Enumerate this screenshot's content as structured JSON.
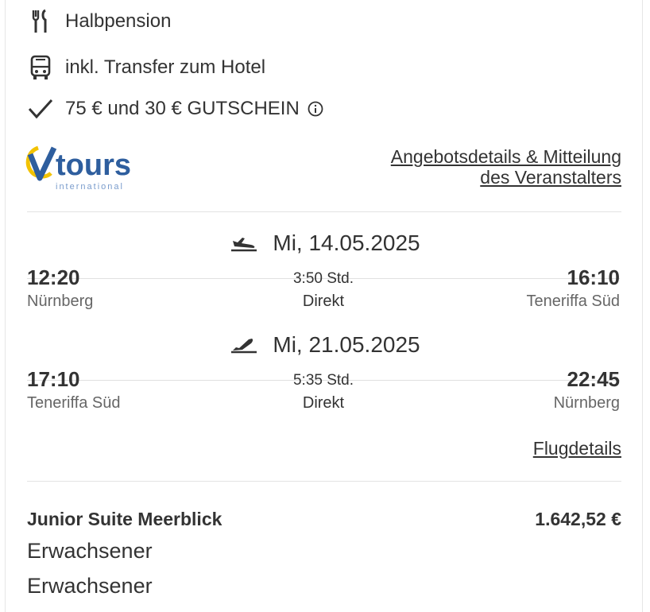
{
  "features": [
    {
      "icon": "cutlery-icon",
      "text": "Halbpension"
    },
    {
      "icon": "bus-icon",
      "text": "inkl. Transfer zum Hotel"
    },
    {
      "icon": "checkmark-icon",
      "text": "75 € und 30 € GUTSCHEIN"
    }
  ],
  "operator": {
    "logo_text": "tours",
    "logo_sub": "international",
    "link_line1": "Angebotsdetails & Mitteilung",
    "link_line2": "des Veranstalters"
  },
  "flights": [
    {
      "direction": "outbound",
      "date": "Mi, 14.05.2025",
      "dep_time": "12:20",
      "dep_city": "Nürnberg",
      "duration": "3:50 Std.",
      "type": "Direkt",
      "arr_time": "16:10",
      "arr_city": "Teneriffa Süd"
    },
    {
      "direction": "return",
      "date": "Mi, 21.05.2025",
      "dep_time": "17:10",
      "dep_city": "Teneriffa Süd",
      "duration": "5:35 Std.",
      "type": "Direkt",
      "arr_time": "22:45",
      "arr_city": "Nürnberg"
    }
  ],
  "flight_details_link": "Flugdetails",
  "room": {
    "name": "Junior Suite Meerblick",
    "price": "1.642,52 €",
    "guests": [
      "Erwachsener",
      "Erwachsener"
    ]
  },
  "colors": {
    "text": "#333333",
    "muted": "#666666",
    "divider": "#e3e3e3",
    "logo_blue": "#2e5e9e",
    "logo_yellow": "#f2c200"
  }
}
